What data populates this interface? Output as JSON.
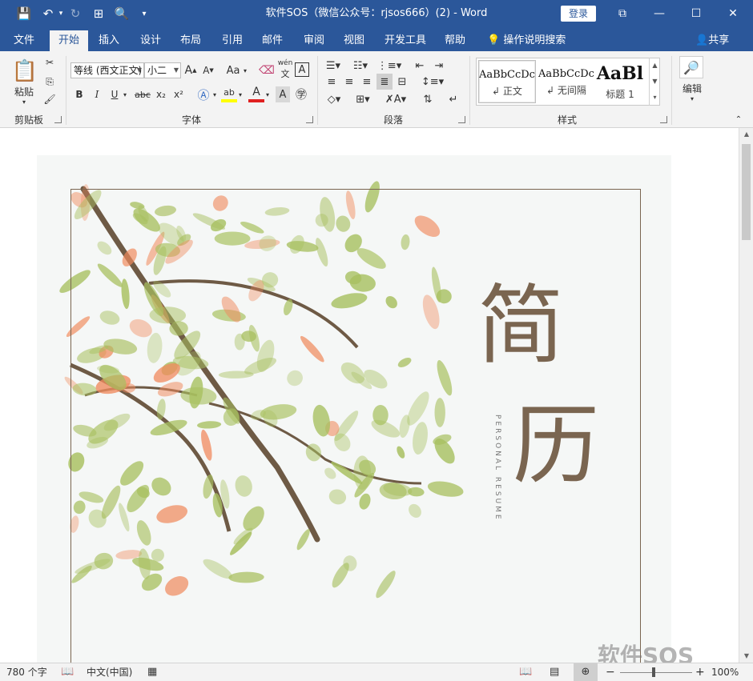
{
  "titlebar": {
    "title": "软件SOS（微信公众号：rjsos666）(2)  -  Word",
    "login": "登录",
    "icons": [
      "save-icon",
      "undo-icon",
      "redo-icon",
      "touch-mode-icon",
      "print-preview-icon",
      "customize-qat-icon"
    ]
  },
  "tabs": [
    "文件",
    "开始",
    "插入",
    "设计",
    "布局",
    "引用",
    "邮件",
    "审阅",
    "视图",
    "开发工具",
    "帮助"
  ],
  "active_tab": "开始",
  "tell_me": "操作说明搜索",
  "share": "共享",
  "ribbon": {
    "clipboard": {
      "label": "剪贴板",
      "paste": "粘贴"
    },
    "font": {
      "label": "字体",
      "font_name": "等线 (西文正文)",
      "font_size": "小二",
      "change_case": "Aa",
      "phonetic": "wén",
      "bold": "B",
      "italic": "I",
      "underline": "U",
      "strike": "abc",
      "sub": "x₂",
      "sup": "x²"
    },
    "paragraph": {
      "label": "段落"
    },
    "styles": {
      "label": "样式",
      "items": [
        {
          "sample": "AaBbCcDc",
          "name": "正文"
        },
        {
          "sample": "AaBbCcDc",
          "name": "无间隔"
        },
        {
          "sample": "AaBl",
          "name": "标题 1"
        }
      ]
    },
    "editing": {
      "label": "编辑"
    }
  },
  "document": {
    "title_char1": "简",
    "title_char2": "历",
    "subtitle": "PERSONAL RESUME",
    "colors": {
      "brown": "#7a6550",
      "leaf_green": "#a8c060",
      "leaf_orange": "#f08a5d"
    }
  },
  "statusbar": {
    "word_count": "780 个字",
    "language": "中文(中国)",
    "zoom": "100%"
  },
  "watermark": "软件SOS"
}
